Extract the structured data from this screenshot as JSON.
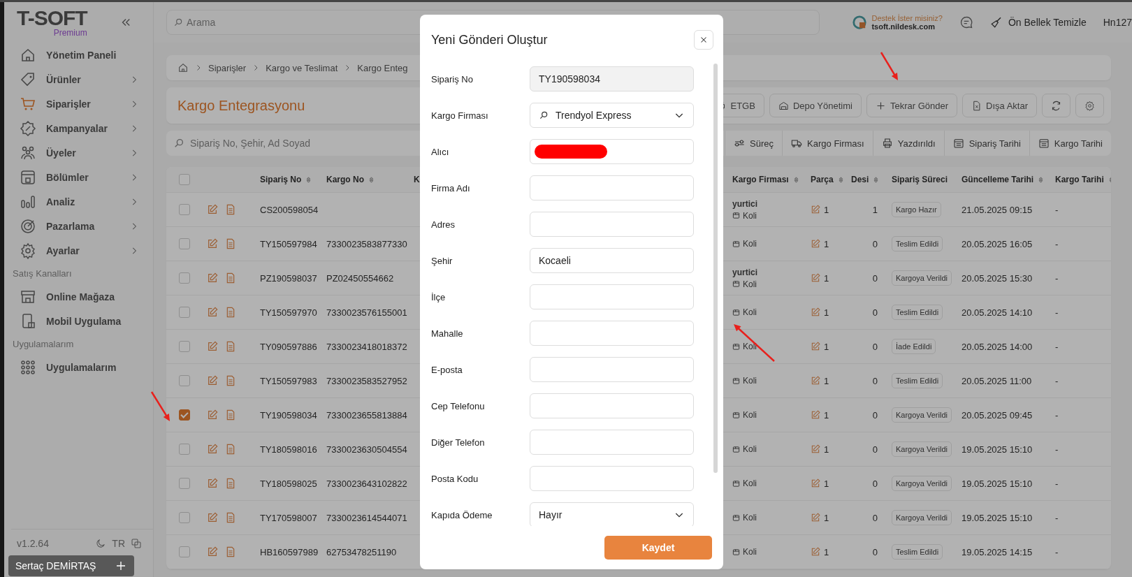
{
  "logo": {
    "name": "T-SOFT",
    "edition": "Premium"
  },
  "sidebar": {
    "sections": [
      {
        "items": [
          {
            "label": "Yönetim Paneli",
            "selected": false,
            "has_submenu": false
          },
          {
            "label": "Ürünler",
            "selected": false,
            "has_submenu": true
          },
          {
            "label": "Siparişler",
            "selected": true,
            "has_submenu": true
          },
          {
            "label": "Kampanyalar",
            "selected": false,
            "has_submenu": true
          },
          {
            "label": "Üyeler",
            "selected": false,
            "has_submenu": true
          },
          {
            "label": "Bölümler",
            "selected": false,
            "has_submenu": true
          },
          {
            "label": "Analiz",
            "selected": false,
            "has_submenu": true
          },
          {
            "label": "Pazarlama",
            "selected": false,
            "has_submenu": true
          },
          {
            "label": "Ayarlar",
            "selected": false,
            "has_submenu": true
          }
        ]
      },
      {
        "title": "Satış Kanalları",
        "items": [
          {
            "label": "Online Mağaza",
            "selected": false,
            "has_submenu": false
          },
          {
            "label": "Mobil Uygulama",
            "selected": false,
            "has_submenu": false
          }
        ]
      },
      {
        "title": "Uygulamalarım",
        "items": [
          {
            "label": "Uygulamalarım",
            "selected": false,
            "has_submenu": false
          }
        ]
      }
    ],
    "footer": {
      "version": "v1.2.64",
      "language": "TR"
    }
  },
  "topbar": {
    "search": {
      "placeholder": "Arama"
    },
    "support": {
      "title": "Destek İster misiniz?",
      "link": "tsoft.nildesk.com"
    },
    "clear_cache": "Ön Bellek Temizle",
    "user": "Hn127"
  },
  "breadcrumb": [
    "Siparişler",
    "Kargo ve Teslimat",
    "Kargo Enteg"
  ],
  "page_title": "Kargo Entegrasyonu",
  "toolbar": [
    {
      "label": "ETGB"
    },
    {
      "label": "Depo Yönetimi"
    },
    {
      "label": "Tekrar Gönder"
    },
    {
      "label": "Dışa Aktar"
    }
  ],
  "filter_search": {
    "placeholder": "Sipariş No, Şehir, Ad Soyad"
  },
  "filters": [
    {
      "label": "Süreç"
    },
    {
      "label": "Kargo Firması"
    },
    {
      "label": "Yazdırıldı"
    },
    {
      "label": "Sipariş Tarihi"
    },
    {
      "label": "Kargo Tarihi"
    }
  ],
  "table": {
    "select_all": {
      "checked": false
    },
    "columns": [
      {
        "label": "Sipariş No",
        "sortable": true
      },
      {
        "label": "Kargo No",
        "sortable": true
      },
      {
        "label": "K",
        "sortable": false
      },
      {
        "label": "Kargo Firması",
        "sortable": true
      },
      {
        "label": "Parça",
        "sortable": true
      },
      {
        "label": "Desi",
        "sortable": true
      },
      {
        "label": "Sipariş Süreci",
        "sortable": false
      },
      {
        "label": "Güncelleme Tarihi",
        "sortable": true
      },
      {
        "label": "Kargo Tarihi",
        "sortable": true
      }
    ],
    "rows": [
      {
        "checked": false,
        "order_no": "CS200598054",
        "carrier": "yurtici",
        "package": "Koli",
        "parts": "1",
        "desi": "1",
        "status": "Kargo Hazır",
        "updated": "21.05.2025 09:15",
        "shipped": "-"
      },
      {
        "checked": false,
        "order_no": "TY150597984",
        "cargo_no": "7330023583877330",
        "package": "Koli",
        "parts": "1",
        "desi": "0",
        "status": "Teslim Edildi",
        "updated": "20.05.2025 16:05",
        "shipped": "-"
      },
      {
        "checked": false,
        "order_no": "PZ190598037",
        "cargo_no": "PZ02450554662",
        "carrier": "yurtici",
        "package": "Koli",
        "parts": "1",
        "desi": "0",
        "status": "Kargoya Verildi",
        "updated": "20.05.2025 15:30",
        "shipped": "-"
      },
      {
        "checked": false,
        "order_no": "TY150597970",
        "cargo_no": "7330023576155001",
        "package": "Koli",
        "parts": "1",
        "desi": "0",
        "status": "Teslim Edildi",
        "updated": "20.05.2025 14:10",
        "shipped": "-"
      },
      {
        "checked": false,
        "order_no": "TY090597886",
        "cargo_no": "7330023418018372",
        "package": "Koli",
        "parts": "1",
        "desi": "0",
        "status": "İade Edildi",
        "updated": "20.05.2025 14:00",
        "shipped": "-"
      },
      {
        "checked": false,
        "order_no": "TY150597983",
        "cargo_no": "7330023583527952",
        "package": "Koli",
        "parts": "1",
        "desi": "0",
        "status": "Teslim Edildi",
        "updated": "20.05.2025 11:00",
        "shipped": "-"
      },
      {
        "checked": true,
        "order_no": "TY190598034",
        "cargo_no": "7330023655813884",
        "package": "Koli",
        "parts": "1",
        "desi": "0",
        "status": "Kargoya Verildi",
        "updated": "20.05.2025 09:45",
        "shipped": "-"
      },
      {
        "checked": false,
        "order_no": "TY180598016",
        "cargo_no": "7330023630504554",
        "package": "Koli",
        "parts": "1",
        "desi": "0",
        "status": "Kargoya Verildi",
        "updated": "19.05.2025 15:10",
        "shipped": "-"
      },
      {
        "checked": false,
        "order_no": "TY180598025",
        "cargo_no": "7330023643102822",
        "package": "Koli",
        "parts": "1",
        "desi": "0",
        "status": "Kargoya Verildi",
        "updated": "19.05.2025 15:10",
        "shipped": "-"
      },
      {
        "checked": false,
        "order_no": "TY170598007",
        "cargo_no": "7330023614544071",
        "package": "Koli",
        "parts": "1",
        "desi": "0",
        "status": "Kargoya Verildi",
        "updated": "19.05.2025 15:10",
        "shipped": "-"
      },
      {
        "checked": false,
        "order_no": "HB160597989",
        "cargo_no": "62753478251190",
        "package": "Koli",
        "parts": "1",
        "desi": "0",
        "status": "Teslim Edildi",
        "updated": "19.05.2025 14:15",
        "shipped": "-"
      }
    ]
  },
  "modal": {
    "title": "Yeni Gönderi Oluştur",
    "fields": [
      {
        "label": "Sipariş No",
        "kind": "readonly",
        "value": "TY190598034"
      },
      {
        "label": "Kargo Firması",
        "kind": "search-select",
        "value": "Trendyol Express"
      },
      {
        "label": "Alıcı",
        "kind": "redacted"
      },
      {
        "label": "Firma Adı",
        "kind": "text"
      },
      {
        "label": "Adres",
        "kind": "text"
      },
      {
        "label": "Şehir",
        "kind": "text",
        "value": "Kocaeli"
      },
      {
        "label": "İlçe",
        "kind": "text"
      },
      {
        "label": "Mahalle",
        "kind": "text"
      },
      {
        "label": "E-posta",
        "kind": "text"
      },
      {
        "label": "Cep Telefonu",
        "kind": "text"
      },
      {
        "label": "Diğer Telefon",
        "kind": "text"
      },
      {
        "label": "Posta Kodu",
        "kind": "text"
      },
      {
        "label": "Kapıda Ödeme",
        "kind": "select",
        "value": "Hayır"
      }
    ],
    "save": "Kaydet"
  },
  "toast": {
    "text": "Sertaç DEMİRTAŞ"
  }
}
